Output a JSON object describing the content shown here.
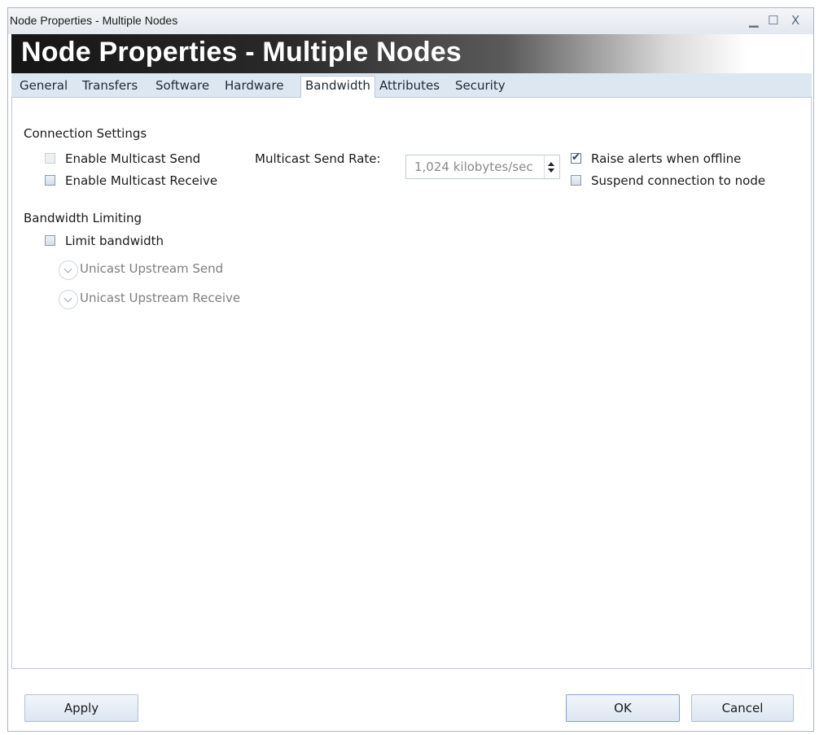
{
  "window": {
    "title": "Node Properties - Multiple Nodes",
    "controls": {
      "minimize": "▁",
      "maximize": "☐",
      "close": "X"
    }
  },
  "banner": {
    "heading": "Node Properties - Multiple Nodes"
  },
  "tabs": [
    {
      "label": "General",
      "active": false
    },
    {
      "label": "Transfers",
      "active": false
    },
    {
      "label": "Software",
      "active": false
    },
    {
      "label": "Hardware",
      "active": false
    },
    {
      "label": "Bandwidth",
      "active": true
    },
    {
      "label": "Attributes",
      "active": false
    },
    {
      "label": "Security",
      "active": false
    }
  ],
  "connection": {
    "heading": "Connection Settings",
    "multicast_send": {
      "label": "Enable Multicast Send",
      "checked": false,
      "enabled": false
    },
    "multicast_receive": {
      "label": "Enable Multicast Receive",
      "checked": false,
      "enabled": true
    },
    "rate_label": "Multicast Send Rate:",
    "rate_value": "1,024 kilobytes/sec",
    "raise_alerts": {
      "label": "Raise alerts when offline",
      "checked": true
    },
    "suspend": {
      "label": "Suspend connection to node",
      "checked": false
    }
  },
  "bandwidth": {
    "heading": "Bandwidth Limiting",
    "limit": {
      "label": "Limit bandwidth",
      "checked": false
    },
    "upstream_send": "Unicast Upstream Send",
    "upstream_receive": "Unicast Upstream Receive"
  },
  "footer": {
    "apply": "Apply",
    "ok": "OK",
    "cancel": "Cancel"
  }
}
